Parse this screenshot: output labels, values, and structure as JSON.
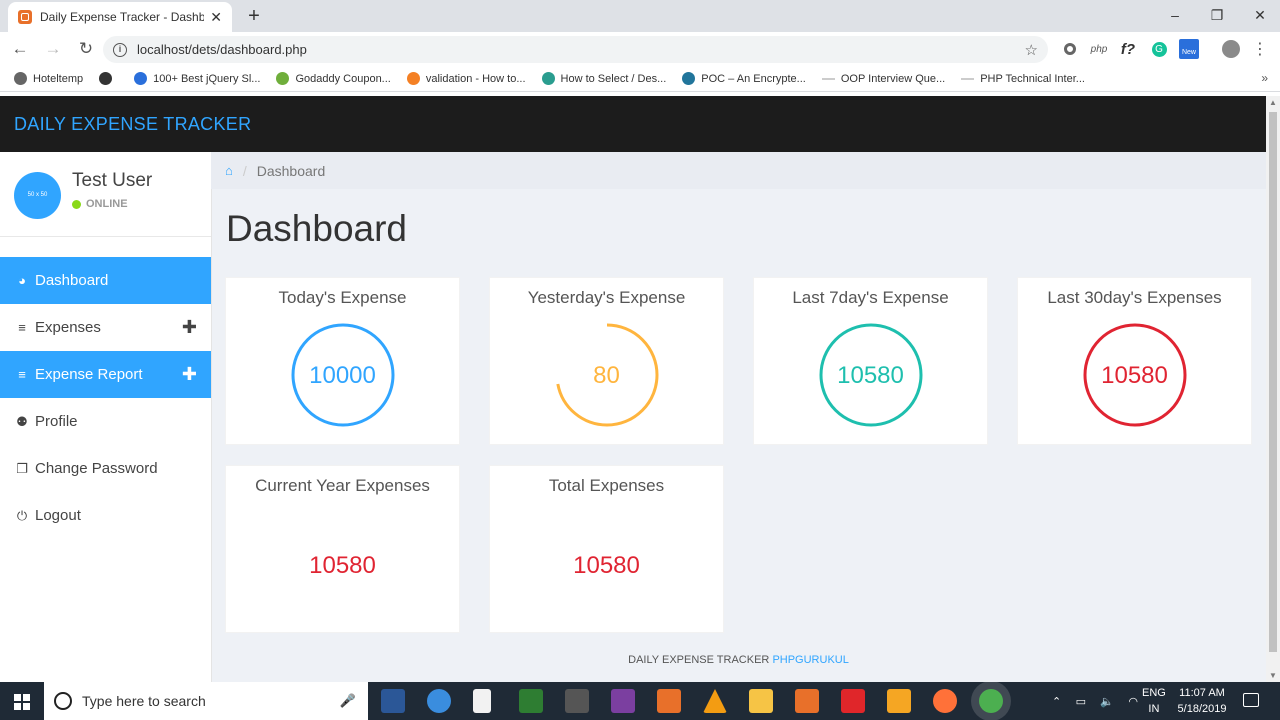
{
  "browser": {
    "tab_title": "Daily Expense Tracker - Dashboa",
    "new_tab": "+",
    "url": "localhost/dets/dashboard.php",
    "minimize": "–",
    "maximize": "❐",
    "close": "✕"
  },
  "bookmarks": [
    {
      "label": "Hoteltemp",
      "color": "#666"
    },
    {
      "label": "",
      "color": "#333"
    },
    {
      "label": "100+ Best jQuery Sl...",
      "color": "#2a6fdb"
    },
    {
      "label": "Godaddy Coupon...",
      "color": "#6fae3b"
    },
    {
      "label": "validation - How to...",
      "color": "#f48024"
    },
    {
      "label": "How to Select / Des...",
      "color": "#2a9d8f"
    },
    {
      "label": "POC – An Encrypte...",
      "color": "#21759b"
    },
    {
      "label": "OOP Interview Que...",
      "color": "#ccc"
    },
    {
      "label": "PHP Technical Inter...",
      "color": "#ccc"
    }
  ],
  "app": {
    "brand": "DAILY EXPENSE TRACKER",
    "user": {
      "name": "Test User",
      "status": "ONLINE",
      "avatar_text": "50 x 50"
    },
    "menu": [
      {
        "label": "Dashboard",
        "icon": "dashboard-icon",
        "glyph": "◕",
        "active": true,
        "plus": ""
      },
      {
        "label": "Expenses",
        "icon": "list-icon",
        "glyph": "≡",
        "active": false,
        "plus": "✚"
      },
      {
        "label": "Expense Report",
        "icon": "list-icon",
        "glyph": "≡",
        "active": true,
        "plus": "✚"
      },
      {
        "label": "Profile",
        "icon": "user-icon",
        "glyph": "⚉",
        "active": false,
        "plus": ""
      },
      {
        "label": "Change Password",
        "icon": "copy-icon",
        "glyph": "❐",
        "active": false,
        "plus": ""
      },
      {
        "label": "Logout",
        "icon": "power-icon",
        "glyph": "⏻",
        "active": false,
        "plus": ""
      }
    ],
    "breadcrumb": "Dashboard",
    "page_title": "Dashboard",
    "cards": [
      {
        "title": "Today's Expense",
        "value": "10000",
        "color": "#30a5ff",
        "progress": 1.0
      },
      {
        "title": "Yesterday's Expense",
        "value": "80",
        "color": "#ffb53e",
        "progress": 0.72
      },
      {
        "title": "Last 7day's Expense",
        "value": "10580",
        "color": "#1ebfae",
        "progress": 1.0
      },
      {
        "title": "Last 30day's Expenses",
        "value": "10580",
        "color": "#e02432",
        "progress": 1.0
      }
    ],
    "totals": [
      {
        "title": "Current Year Expenses",
        "value": "10580"
      },
      {
        "title": "Total Expenses",
        "value": "10580"
      }
    ],
    "footer": {
      "text": "DAILY EXPENSE TRACKER",
      "link": "PHPGURUKUL"
    }
  },
  "taskbar": {
    "search_placeholder": "Type here to search",
    "lang_top": "ENG",
    "lang_bottom": "IN",
    "time": "11:07 AM",
    "date": "5/18/2019"
  }
}
